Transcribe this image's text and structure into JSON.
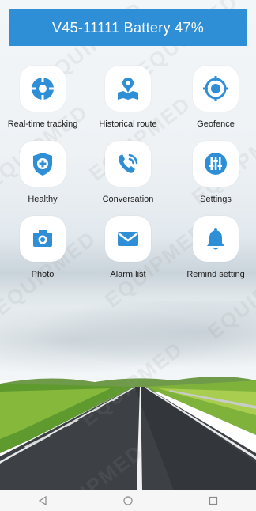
{
  "header": {
    "title": "V45-11111 Battery 47%"
  },
  "apps": [
    {
      "label": "Real-time tracking",
      "icon": "crosshair-target-icon"
    },
    {
      "label": "Historical route",
      "icon": "map-pin-route-icon"
    },
    {
      "label": "Geofence",
      "icon": "geofence-target-icon"
    },
    {
      "label": "Healthy",
      "icon": "health-shield-icon"
    },
    {
      "label": "Conversation",
      "icon": "phone-call-icon"
    },
    {
      "label": "Settings",
      "icon": "sliders-settings-icon"
    },
    {
      "label": "Photo",
      "icon": "camera-icon"
    },
    {
      "label": "Alarm list",
      "icon": "envelope-icon"
    },
    {
      "label": "Remind setting",
      "icon": "bell-icon"
    }
  ],
  "navbar": {
    "back": "back-triangle-icon",
    "home": "home-circle-icon",
    "recents": "recents-square-icon"
  },
  "watermark": {
    "text": "EQUIPMED"
  },
  "colors": {
    "header_bg": "#2f8fd6",
    "icon_blue": "#2f8fd6",
    "tile_bg": "#ffffff"
  }
}
